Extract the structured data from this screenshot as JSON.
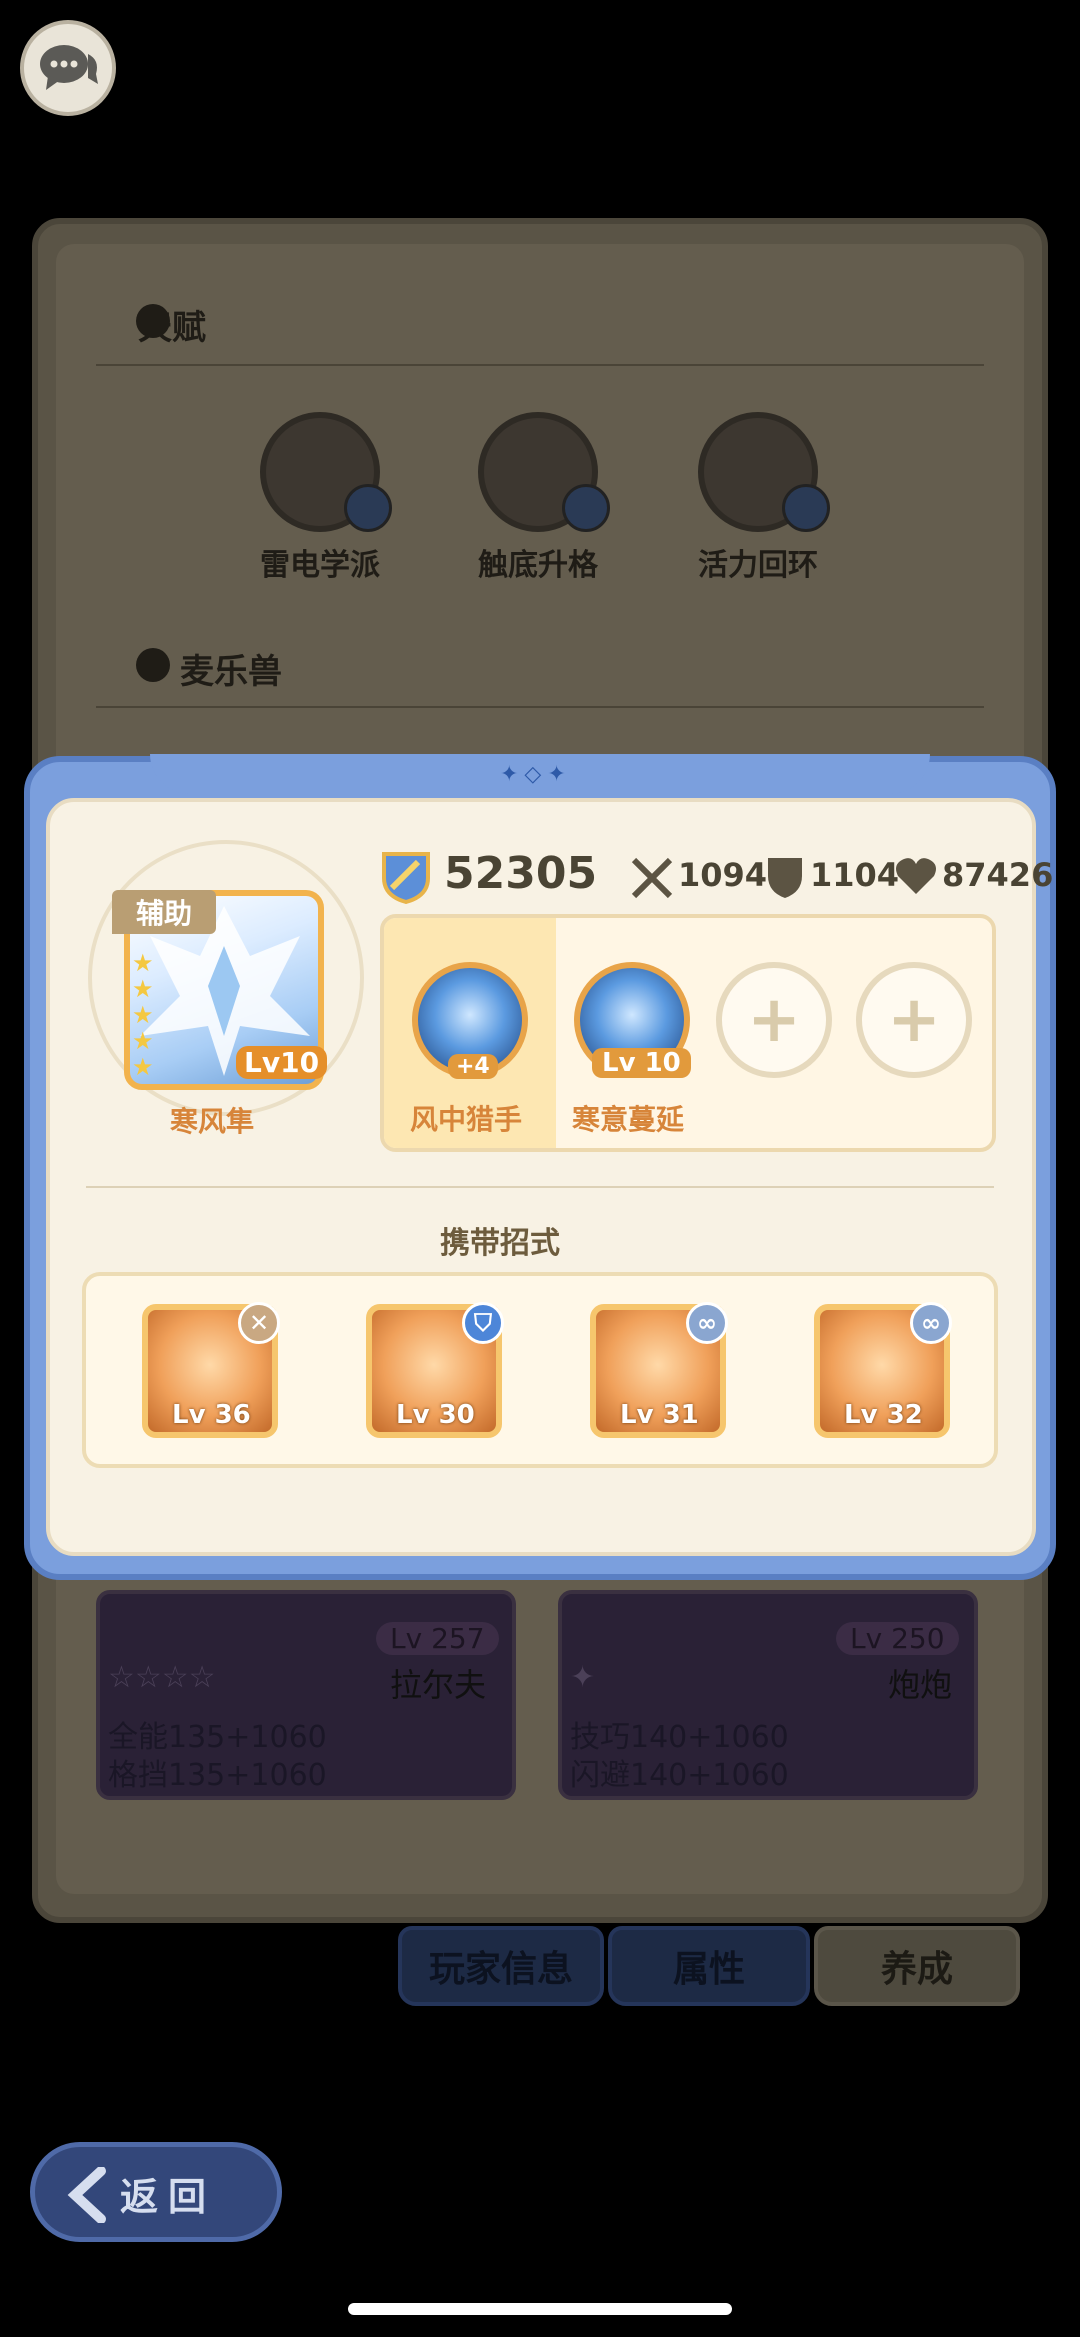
{
  "background": {
    "talent_title": "天赋",
    "talents": [
      {
        "name": "雷电学派"
      },
      {
        "name": "触底升格"
      },
      {
        "name": "活力回环"
      }
    ],
    "beast_title": "麦乐兽",
    "beasts": [
      {
        "lv": "Lv 257",
        "name": "拉尔夫",
        "stat1": "全能135+1060",
        "stat2": "格挡135+1060"
      },
      {
        "lv": "Lv 250",
        "name": "炮炮",
        "stat1": "技巧140+1060",
        "stat2": "闪避140+1060"
      }
    ],
    "tabs": [
      "玩家信息",
      "属性",
      "养成"
    ]
  },
  "modal": {
    "pet": {
      "role": "辅助",
      "level": "Lv10",
      "name": "寒风隼"
    },
    "power": "52305",
    "stats": {
      "attack": "1094",
      "defense": "1104",
      "hp": "87426"
    },
    "skills": [
      {
        "name": "风中猎手",
        "badge": "+4"
      },
      {
        "name": "寒意蔓延",
        "badge": "Lv 10"
      }
    ],
    "moves_title": "携带招式",
    "moves": [
      {
        "lv": "Lv 36",
        "badge": "x"
      },
      {
        "lv": "Lv 30",
        "badge": "shield"
      },
      {
        "lv": "Lv 31",
        "badge": "link"
      },
      {
        "lv": "Lv 32",
        "badge": "link"
      }
    ]
  },
  "back_label": "返回"
}
